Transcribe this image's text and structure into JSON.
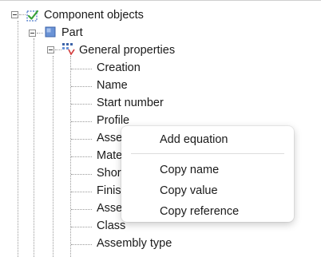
{
  "tree": {
    "root": {
      "label": "Component objects",
      "icon": "component-objects-icon"
    },
    "part": {
      "label": "Part",
      "icon": "part-cube-icon"
    },
    "general": {
      "label": "General properties",
      "icon": "property-group-icon"
    },
    "items": [
      "Creation",
      "Name",
      "Start number",
      "Profile",
      "Asser",
      "Mate",
      "Short",
      "Finish",
      "Asser",
      "Class",
      "Assembly type"
    ]
  },
  "context_menu": {
    "items": [
      {
        "label": "Add equation"
      },
      {
        "label": "Copy name"
      },
      {
        "label": "Copy value"
      },
      {
        "label": "Copy reference"
      }
    ]
  },
  "colors": {
    "background": "#ffffff",
    "check_green": "#3aa33a",
    "part_blue": "#4a78c9",
    "dot_lines": "#9a9a9a"
  }
}
